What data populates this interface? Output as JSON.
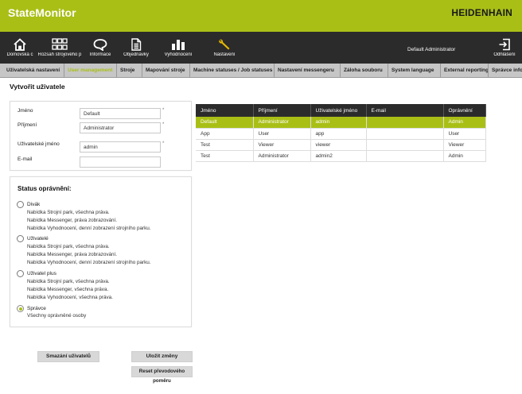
{
  "app": {
    "title": "StateMonitor",
    "brand": "HEIDENHAIN",
    "user": "Default Administrator"
  },
  "colors": {
    "accent": "#a9bf16",
    "nav_bg": "#2b2b2b",
    "tab_bg": "#c6c6c6"
  },
  "nav": {
    "items": [
      {
        "label": "Domovská c",
        "icon": "home-icon"
      },
      {
        "label": "Rozsah strojového p",
        "icon": "grid-icon"
      },
      {
        "label": "Informace",
        "icon": "chat-icon"
      },
      {
        "label": "Objednávky",
        "icon": "document-icon"
      },
      {
        "label": "Vyhodnocení",
        "icon": "bar-chart-icon"
      },
      {
        "label": "Nastavení",
        "icon": "wrench-icon"
      }
    ],
    "logout": {
      "label": "Odhlášení",
      "icon": "logout-icon"
    }
  },
  "tabs": [
    {
      "label": "Uživatelská nastavení"
    },
    {
      "label": "User management",
      "active": true
    },
    {
      "label": "Stroje"
    },
    {
      "label": "Mapování stroje"
    },
    {
      "label": "Machine statuses / Job statuses"
    },
    {
      "label": "Nastavení messengeru"
    },
    {
      "label": "Záloha souboru"
    },
    {
      "label": "System language"
    },
    {
      "label": "External reporting BI"
    },
    {
      "label": "Správce info"
    }
  ],
  "page": {
    "title": "Vytvořit uživatele"
  },
  "form": {
    "first_name": {
      "label": "Jméno",
      "value": "Default"
    },
    "last_name": {
      "label": "Příjmení",
      "value": "Administrator"
    },
    "username": {
      "label": "Uživatelské jméno",
      "value": "admin"
    },
    "email": {
      "label": "E-mail",
      "value": ""
    },
    "required_mark": "*"
  },
  "permissions": {
    "title": "Status oprávnění:",
    "roles": [
      {
        "name": "Divák",
        "lines": [
          "Nabídka Strojní park, všechna práva.",
          "Nabídka Messenger, práva zobrazování.",
          "Nabídka Vyhodnocení, denní zobrazení strojního parku."
        ],
        "selected": false
      },
      {
        "name": "Uživatelé",
        "lines": [
          "Nabídka Strojní park, všechna práva.",
          "Nabídka Messenger, práva zobrazování.",
          "Nabídka Vyhodnocení, denní zobrazení strojního parku."
        ],
        "selected": false
      },
      {
        "name": "Uživatel plus",
        "lines": [
          "Nabídka Strojní park, všechna práva.",
          "Nabídka Messenger, všechna práva.",
          "Nabídka Vyhodnocení, všechna práva."
        ],
        "selected": false
      },
      {
        "name": "Správce",
        "lines": [
          "Všechny oprávněné osoby"
        ],
        "selected": true
      }
    ]
  },
  "buttons": {
    "delete": "Smazání uživatelů",
    "save": "Uložit změny",
    "reset": "Reset převodového poměru"
  },
  "users_table": {
    "headers": [
      "Jméno",
      "Příjmení",
      "Uživatelské jméno",
      "E-mail",
      "Oprávnění"
    ],
    "rows": [
      {
        "cells": [
          "Default",
          "Administrator",
          "admin",
          "",
          "Admin"
        ],
        "selected": true
      },
      {
        "cells": [
          "App",
          "User",
          "app",
          "",
          "User"
        ],
        "selected": false
      },
      {
        "cells": [
          "Test",
          "Viewer",
          "viewer",
          "",
          "Viewer"
        ],
        "selected": false
      },
      {
        "cells": [
          "Test",
          "Administrator",
          "admin2",
          "",
          "Admin"
        ],
        "selected": false
      }
    ]
  }
}
